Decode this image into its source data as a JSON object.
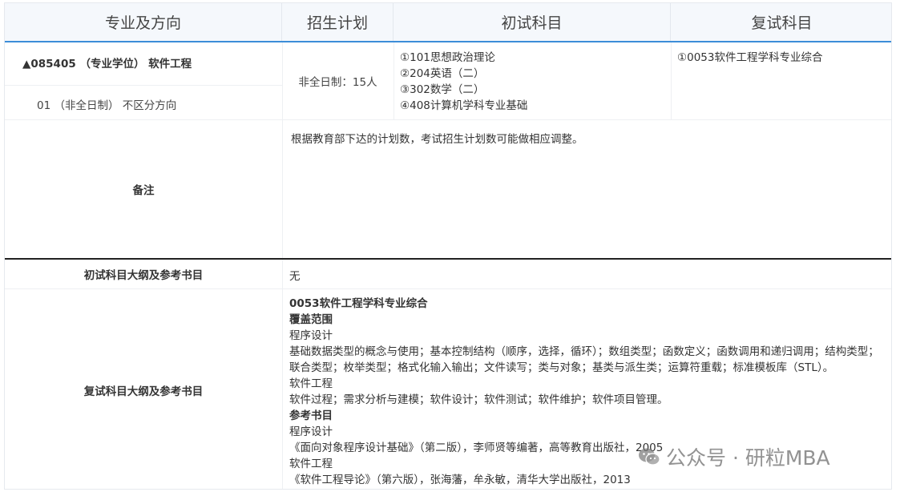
{
  "header": {
    "col1": "专业及方向",
    "col2": "招生计划",
    "col3": "初试科目",
    "col4": "复试科目"
  },
  "major": {
    "title": "▲085405 （专业学位） 软件工程",
    "direction": "01 （非全日制） 不区分方向",
    "plan": "非全日制：15人",
    "initial_subjects": [
      "①101思想政治理论",
      "②204英语（二）",
      "③302数学（二）",
      "④408计算机学科专业基础"
    ],
    "retest_subjects": [
      "①0053软件工程学科专业综合"
    ]
  },
  "remarks": {
    "label": "备注",
    "text": "根据教育部下达的计划数，考试招生计划数可能做相应调整。"
  },
  "initial_syllabus": {
    "label": "初试科目大纲及参考书目",
    "text": "无"
  },
  "retest_syllabus": {
    "label": "复试科目大纲及参考书目",
    "subject_title": "0053软件工程学科专业综合",
    "coverage_heading": "覆盖范围",
    "programming_heading": "程序设计",
    "programming_content": "基础数据类型的概念与使用；基本控制结构（顺序，选择，循环）；数组类型；函数定义；函数调用和递归调用；结构类型；联合类型；枚举类型；格式化输入输出；文件读写；类与对象；基类与派生类；运算符重载；标准模板库（STL）。",
    "se_heading": "软件工程",
    "se_content": "软件过程；需求分析与建模；软件设计；软件测试；软件维护；软件项目管理。",
    "refs_heading": "参考书目",
    "ref_prog_heading": "程序设计",
    "ref_prog_book": "《面向对象程序设计基础》（第二版），李师贤等编著，高等教育出版社，2005",
    "ref_se_heading": "软件工程",
    "ref_se_book": "《软件工程导论》（第六版），张海藩，牟永敏，清华大学出版社，2013"
  },
  "watermark": {
    "text": "公众号 · 研粒MBA",
    "icon": "wechat-icon"
  }
}
